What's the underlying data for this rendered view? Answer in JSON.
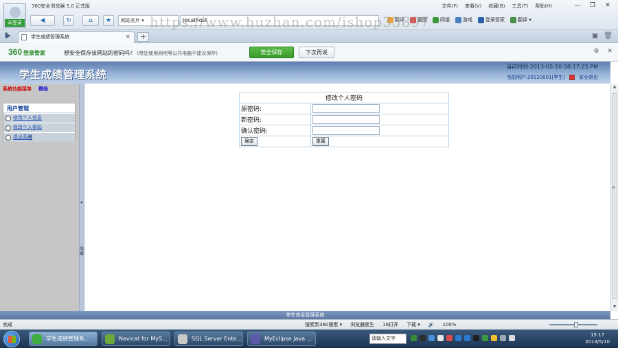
{
  "browser": {
    "app_title": "360安全浏览器 5.0 正式版",
    "login_label": "未登录",
    "menu": [
      "文件(F)",
      "查看(V)",
      "收藏(B)",
      "工具(T)",
      "帮助(H)"
    ],
    "win_buttons": [
      "—",
      "❐",
      "✕"
    ],
    "address_label": "网站名片 ▾",
    "url": "localhost",
    "toolbar_items": [
      "翻译",
      "截图",
      "网银",
      "游戏",
      "登录管家",
      "翻译 ▾"
    ],
    "tab_title": "学生成绩管理系统",
    "tab_close": "×",
    "newtab": "+",
    "nav_symbols": [
      "◀",
      "▸",
      "↻",
      "⌂",
      "★"
    ]
  },
  "password_bar": {
    "logo": "360",
    "logo_sub": "登录管家",
    "message": "想安全保存该网站的密码吗？",
    "note": "(带您使用网吧等公共电脑不建议保存)",
    "save_label": "安全保存",
    "later_label": "下次再说",
    "icons": [
      "⚙",
      "✕"
    ]
  },
  "page": {
    "system_title": "学生成绩管理系统",
    "current_time": "当前时间:2013-05-10 08:17:25 PM",
    "current_user": "当前用户:20120001[学生]",
    "logout_label": "安全退出",
    "left_nav": [
      "系统功能菜单",
      "帮助"
    ],
    "user_menu": {
      "heading": "用户管理",
      "items": [
        "修改个人信息",
        "修改个人密码",
        "退出系统"
      ]
    },
    "splitter_arrow": "◂",
    "splitter_text": "隐藏",
    "form": {
      "caption": "修改个人密码",
      "old_label": "原密码:",
      "new_label": "新密码:",
      "confirm_label": "确认密码:",
      "submit_label": "确定",
      "reset_label": "重置"
    },
    "footer": "学生信息管理系统"
  },
  "statusbar": {
    "left": "完成",
    "items": [
      "搜索到360搜索 ▾",
      "浏览器医生",
      "16打开",
      "下载 ▾"
    ],
    "zoom": "100%"
  },
  "taskbar": {
    "tasks": [
      "学生成绩管理系...",
      "Navicat for MyS...",
      "SQL Server Ente...",
      "MyEclipse Java ..."
    ],
    "ime": "请输入文字",
    "time": "15:17",
    "date": "2013/5/10"
  },
  "watermark": "https://www.huzhan.com/ishop33897",
  "colors": {
    "header_blue": "#7d9ac8",
    "green_save": "#369a2a",
    "link_blue": "#1b4fb5"
  }
}
